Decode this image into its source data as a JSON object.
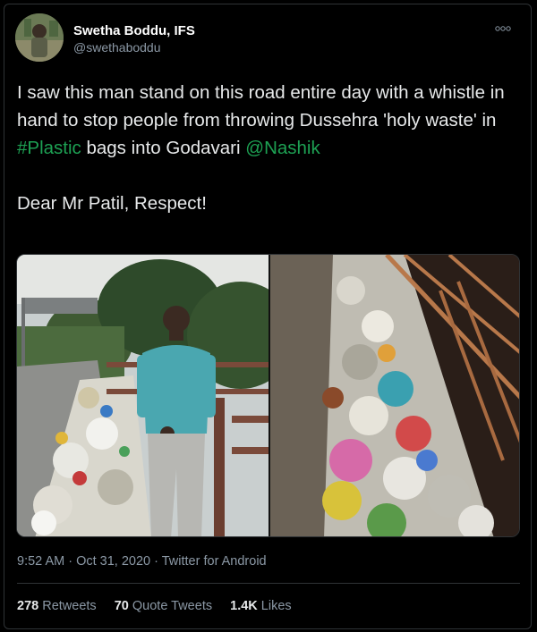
{
  "user": {
    "display_name": "Swetha Boddu, IFS",
    "handle": "@swethaboddu"
  },
  "more_icon": "more-horizontal-icon",
  "tweet": {
    "line1_before": "I saw this man stand on this road entire day with a whistle in hand to stop people from throwing Dussehra 'holy waste' in ",
    "hashtag": "#Plastic",
    "line1_after": " bags into Godavari ",
    "mention": "@Nashik",
    "line2": "Dear Mr Patil, Respect!"
  },
  "meta": {
    "time": "9:52 AM",
    "separator": " · ",
    "date": "Oct 31, 2020",
    "source": "Twitter for Android"
  },
  "stats": {
    "retweets_count": "278",
    "retweets_label": "Retweets",
    "quotes_count": "70",
    "quotes_label": "Quote Tweets",
    "likes_count": "1.4K",
    "likes_label": "Likes"
  },
  "colors": {
    "background": "#000000",
    "link": "#1da153",
    "secondary_text": "#8b98a5",
    "divider": "#2f3336"
  }
}
